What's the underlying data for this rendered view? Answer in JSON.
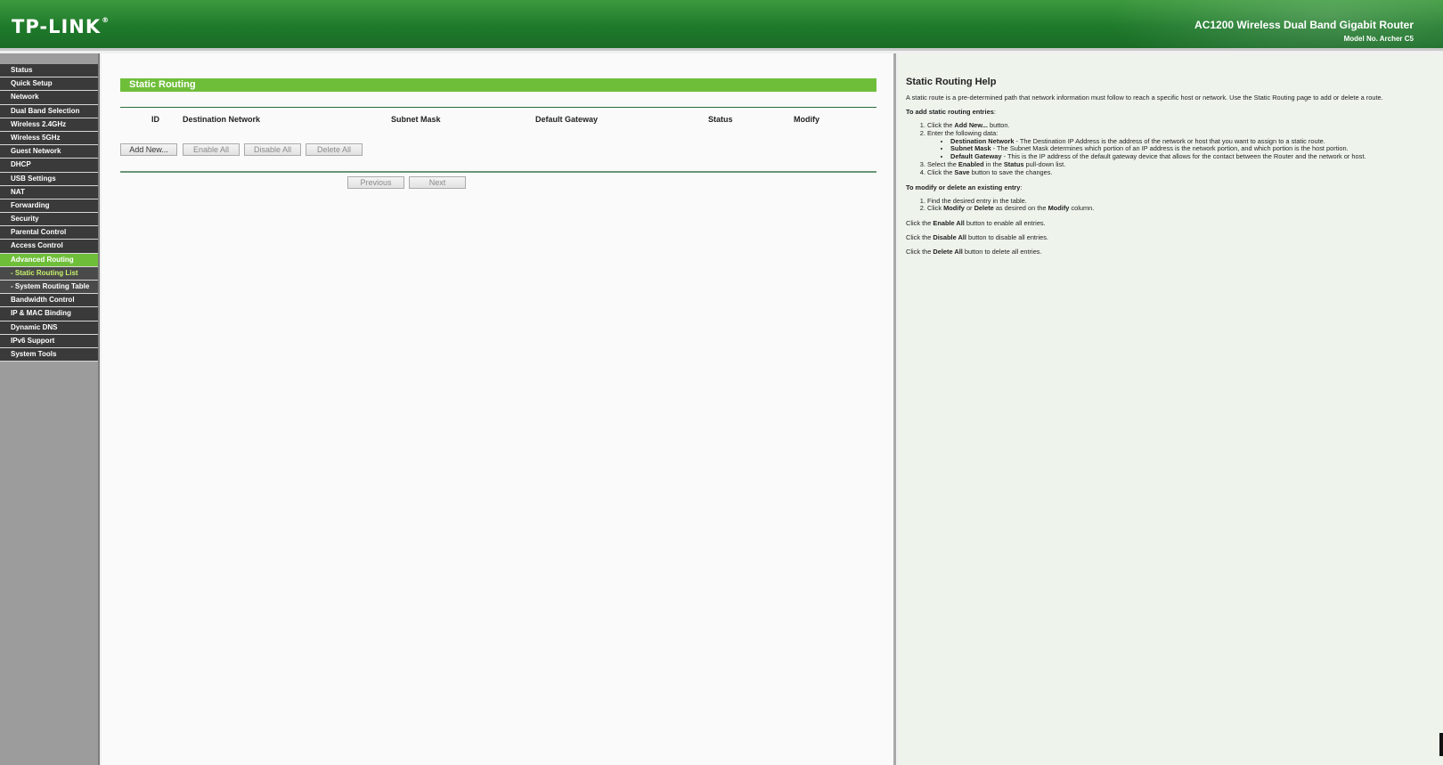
{
  "header": {
    "logo": "TP-LINK",
    "logo_reg": "®",
    "product_name": "AC1200 Wireless Dual Band Gigabit Router",
    "model": "Model No. Archer C5"
  },
  "sidebar": {
    "items": [
      {
        "label": "Status"
      },
      {
        "label": "Quick Setup"
      },
      {
        "label": "Network"
      },
      {
        "label": "Dual Band Selection"
      },
      {
        "label": "Wireless 2.4GHz"
      },
      {
        "label": "Wireless 5GHz"
      },
      {
        "label": "Guest Network"
      },
      {
        "label": "DHCP"
      },
      {
        "label": "USB Settings"
      },
      {
        "label": "NAT"
      },
      {
        "label": "Forwarding"
      },
      {
        "label": "Security"
      },
      {
        "label": "Parental Control"
      },
      {
        "label": "Access Control"
      },
      {
        "label": "Advanced Routing"
      },
      {
        "label": "- Static Routing List"
      },
      {
        "label": "- System Routing Table"
      },
      {
        "label": "Bandwidth Control"
      },
      {
        "label": "IP & MAC Binding"
      },
      {
        "label": "Dynamic DNS"
      },
      {
        "label": "IPv6 Support"
      },
      {
        "label": "System Tools"
      }
    ]
  },
  "main": {
    "title": "Static Routing",
    "columns": [
      "ID",
      "Destination Network",
      "Subnet Mask",
      "Default Gateway",
      "Status",
      "Modify"
    ],
    "buttons": {
      "add_new": "Add New...",
      "enable_all": "Enable All",
      "disable_all": "Disable All",
      "delete_all": "Delete All",
      "previous": "Previous",
      "next": "Next"
    }
  },
  "help": {
    "title": "Static Routing Help",
    "intro": "A static route is a pre-determined path that network information must follow to reach a specific host or network. Use the Static Routing page to add or delete a route.",
    "add_heading": "To add static routing entries",
    "add_heading_suffix": ":",
    "step1_pre": "Click the ",
    "step1_b": "Add New...",
    "step1_post": " button.",
    "step2": "Enter the following data:",
    "dest_b": "Destination Network",
    "dest_text": " - The Destination IP Address is the address of the network or host that you want to assign to a static route.",
    "mask_b": "Subnet Mask",
    "mask_text": " - The Subnet Mask determines which portion of an IP address is the network portion, and which portion is the host portion.",
    "gw_b": "Default Gateway",
    "gw_text": " - This is the IP address of the default gateway device that allows for the contact between the Router and the network or host.",
    "step3_pre": "Select the ",
    "step3_b1": "Enabled",
    "step3_mid": " in the ",
    "step3_b2": "Status",
    "step3_post": " pull-down list.",
    "step4_pre": "Click the ",
    "step4_b": "Save",
    "step4_post": " button to save the changes.",
    "modify_heading": "To modify or delete an existing entry",
    "modify_heading_suffix": ":",
    "m1": "Find the desired entry in the table.",
    "m2_pre": "Click ",
    "m2_b1": "Modify",
    "m2_mid1": " or ",
    "m2_b2": "Delete",
    "m2_mid2": " as desired on the ",
    "m2_b3": "Modify",
    "m2_post": " column.",
    "enable_pre": "Click the ",
    "enable_b": "Enable All",
    "enable_post": " button to enable all entries.",
    "disable_pre": "Click the ",
    "disable_b": "Disable All",
    "disable_post": " button to disable all entries.",
    "delete_pre": "Click the ",
    "delete_b": "Delete All",
    "delete_post": " button to delete all entries."
  }
}
